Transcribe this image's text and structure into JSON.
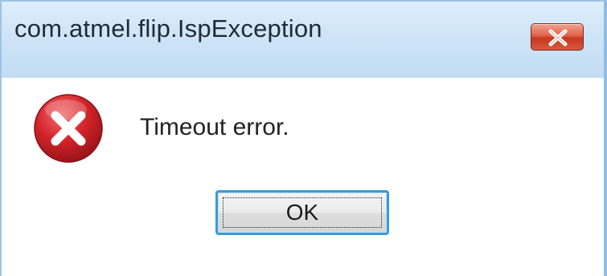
{
  "dialog": {
    "title": "com.atmel.flip.IspException",
    "close_icon": "close-x-icon",
    "message": "Timeout error.",
    "status_icon": "error-icon",
    "ok_label": "OK"
  },
  "colors": {
    "title_bar": "#cfe4f7",
    "close_button": "#d9533b",
    "error_red": "#d2232a",
    "focus_border": "#3c9ad6"
  }
}
